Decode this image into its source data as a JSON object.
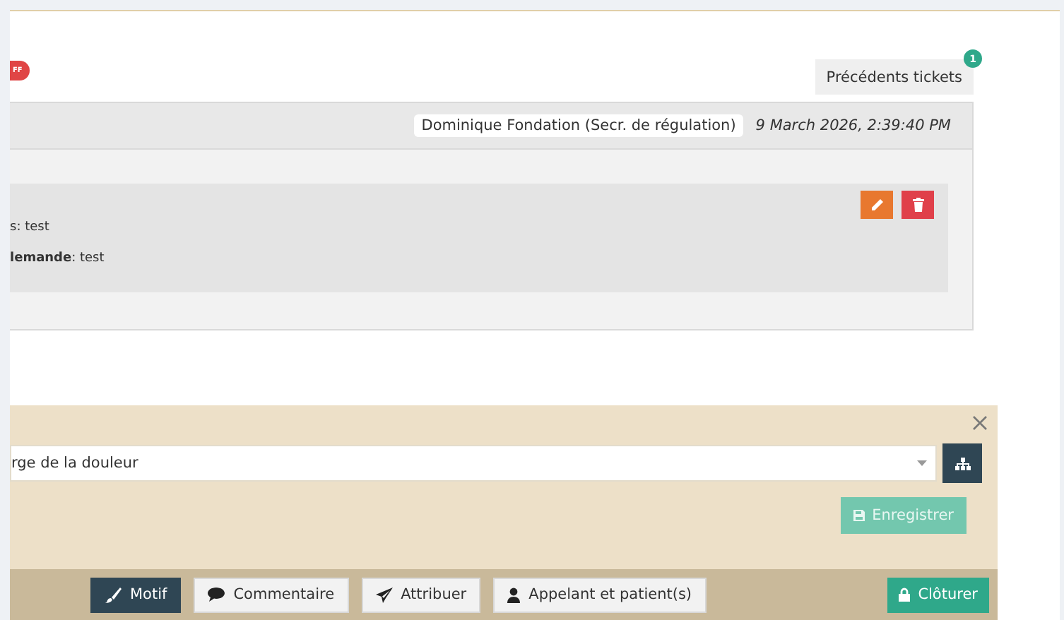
{
  "status_badge": {
    "label": "FF"
  },
  "previous_tickets": {
    "label": "Précédents tickets",
    "count": "1"
  },
  "entry": {
    "author": "Dominique Fondation (Secr. de régulation)",
    "date": "9 March 2026, 2:39:40 PM",
    "lines": [
      "s: test",
      "**lemande**: test"
    ],
    "actions": [
      {
        "kind": "edit"
      },
      {
        "kind": "delete"
      }
    ]
  },
  "form": {
    "value": "rge de la douleur",
    "save_label": "Enregistrer"
  },
  "toolbar": [
    {
      "label": "Motif",
      "kind": "brush",
      "selected": true
    },
    {
      "label": "Commentaire",
      "kind": "comment",
      "selected": false
    },
    {
      "label": "Attribuer",
      "kind": "send",
      "selected": false
    },
    {
      "label": "Appelant et patient(s)",
      "kind": "user",
      "selected": false
    }
  ],
  "close_ticket": {
    "label": "Clôturer"
  }
}
